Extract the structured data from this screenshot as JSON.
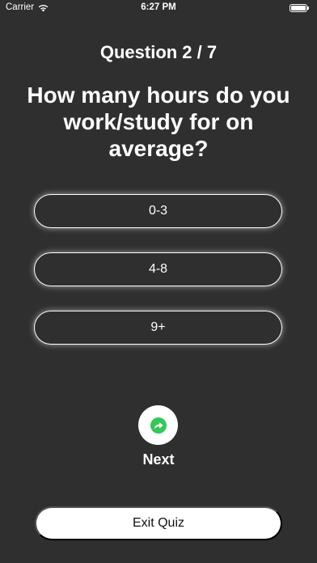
{
  "status_bar": {
    "carrier": "Carrier",
    "time": "6:27 PM",
    "wifi_icon": "wifi-icon",
    "battery_icon": "battery-full-icon"
  },
  "quiz": {
    "counter": "Question 2 / 7",
    "question": "How many hours do you work/study for on average?",
    "options": [
      {
        "label": "0-3"
      },
      {
        "label": "4-8"
      },
      {
        "label": "9+"
      }
    ],
    "next": {
      "icon": "share-forward-icon",
      "icon_color": "#34c759",
      "label": "Next"
    },
    "exit_label": "Exit Quiz"
  },
  "colors": {
    "background": "#2f2f2f",
    "accent": "#34c759",
    "text": "#ffffff"
  }
}
